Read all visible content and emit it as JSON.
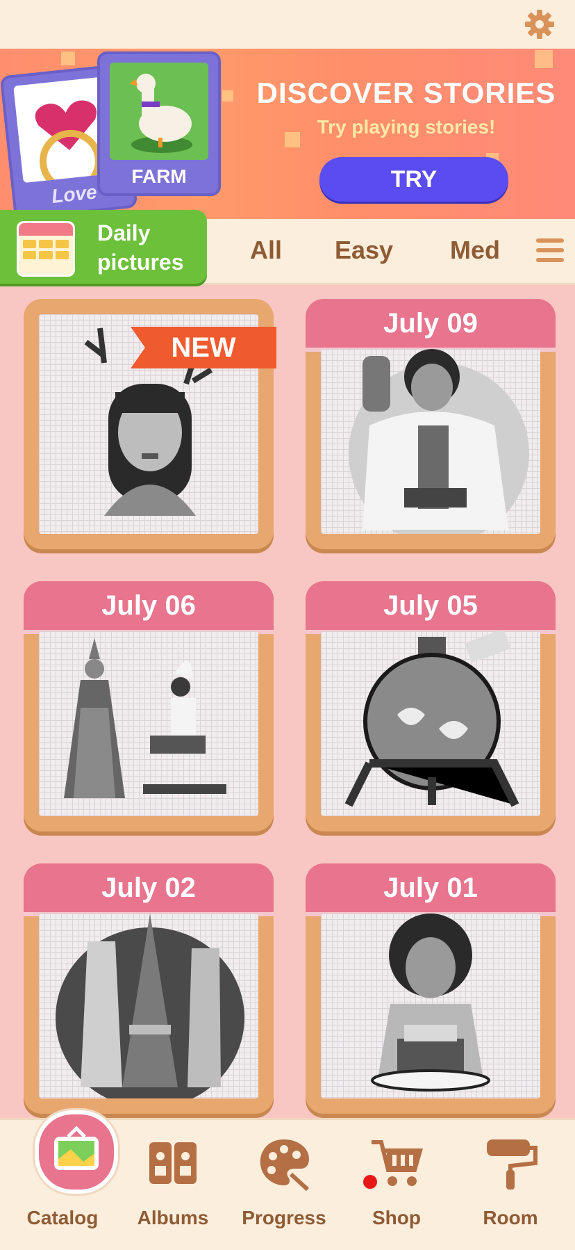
{
  "colors": {
    "accent": "#e8748e",
    "brand_green": "#6dc03a",
    "try_button": "#5a4cf0",
    "text_brown": "#8e5b34"
  },
  "banner": {
    "title": "DISCOVER STORIES",
    "subtitle": "Try playing stories!",
    "try_label": "TRY",
    "cards": [
      {
        "caption": "Love"
      },
      {
        "caption": "FARM"
      }
    ]
  },
  "daily": {
    "line1": "Daily",
    "line2": "pictures",
    "icon": "calendar-icon"
  },
  "filters": {
    "tabs": [
      "All",
      "Easy",
      "Med"
    ],
    "menu_icon": "hamburger-icon"
  },
  "tiles": [
    {
      "date": "",
      "badge": "NEW"
    },
    {
      "date": "July 09"
    },
    {
      "date": "July 06"
    },
    {
      "date": "July 05"
    },
    {
      "date": "July 02"
    },
    {
      "date": "July 01"
    }
  ],
  "nav": {
    "items": [
      {
        "label": "Catalog",
        "icon": "picture-frame-icon"
      },
      {
        "label": "Albums",
        "icon": "album-icon"
      },
      {
        "label": "Progress",
        "icon": "palette-icon"
      },
      {
        "label": "Shop",
        "icon": "cart-icon"
      },
      {
        "label": "Room",
        "icon": "paint-roller-icon"
      }
    ]
  },
  "settings_icon": "gear-icon"
}
